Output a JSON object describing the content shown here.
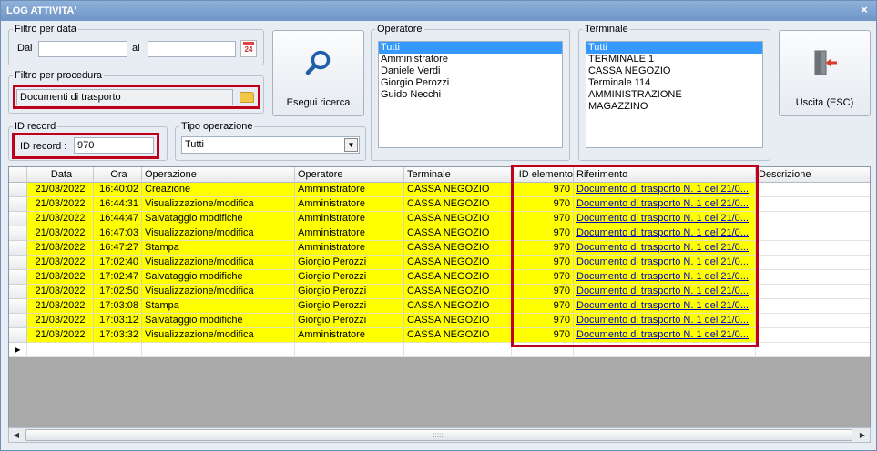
{
  "window": {
    "title": "LOG ATTIVITA'",
    "close_glyph": "×"
  },
  "filtro_data": {
    "label": "Filtro per data",
    "dal_label": "Dal",
    "al_label": "al",
    "dal_value": "",
    "al_value": "",
    "calendar_text": "24"
  },
  "filtro_procedura": {
    "label": "Filtro per procedura",
    "value": "Documenti di trasporto"
  },
  "id_record": {
    "label": "ID record",
    "field_label": "ID record :",
    "value": "970"
  },
  "tipo_operazione": {
    "label": "Tipo operazione",
    "selected": "Tutti"
  },
  "search_button": {
    "label": "Esegui ricerca"
  },
  "exit_button": {
    "label": "Uscita (ESC)"
  },
  "operatore": {
    "label": "Operatore",
    "items": [
      "Tutti",
      "Amministratore",
      "Daniele Verdi",
      "Giorgio Perozzi",
      "Guido Necchi"
    ],
    "selected_index": 0
  },
  "terminale": {
    "label": "Terminale",
    "items": [
      "Tutti",
      "TERMINALE 1",
      "CASSA NEGOZIO",
      "Terminale 114",
      "AMMINISTRAZIONE",
      "MAGAZZINO"
    ],
    "selected_index": 0
  },
  "grid": {
    "headers": [
      "Data",
      "Ora",
      "Operazione",
      "Operatore",
      "Terminale",
      "ID elemento",
      "Riferimento",
      "Descrizione"
    ],
    "rows": [
      [
        "21/03/2022",
        "16:40:02",
        "Creazione",
        "Amministratore",
        "CASSA NEGOZIO",
        "970",
        "Documento di trasporto N. 1 del 21/0...",
        ""
      ],
      [
        "21/03/2022",
        "16:44:31",
        "Visualizzazione/modifica",
        "Amministratore",
        "CASSA NEGOZIO",
        "970",
        "Documento di trasporto N. 1 del 21/0...",
        ""
      ],
      [
        "21/03/2022",
        "16:44:47",
        "Salvataggio modifiche",
        "Amministratore",
        "CASSA NEGOZIO",
        "970",
        "Documento di trasporto N. 1 del 21/0...",
        ""
      ],
      [
        "21/03/2022",
        "16:47:03",
        "Visualizzazione/modifica",
        "Amministratore",
        "CASSA NEGOZIO",
        "970",
        "Documento di trasporto N. 1 del 21/0...",
        ""
      ],
      [
        "21/03/2022",
        "16:47:27",
        "Stampa",
        "Amministratore",
        "CASSA NEGOZIO",
        "970",
        "Documento di trasporto N. 1 del 21/0...",
        ""
      ],
      [
        "21/03/2022",
        "17:02:40",
        "Visualizzazione/modifica",
        "Giorgio Perozzi",
        "CASSA NEGOZIO",
        "970",
        "Documento di trasporto N. 1 del 21/0...",
        ""
      ],
      [
        "21/03/2022",
        "17:02:47",
        "Salvataggio modifiche",
        "Giorgio Perozzi",
        "CASSA NEGOZIO",
        "970",
        "Documento di trasporto N. 1 del 21/0...",
        ""
      ],
      [
        "21/03/2022",
        "17:02:50",
        "Visualizzazione/modifica",
        "Giorgio Perozzi",
        "CASSA NEGOZIO",
        "970",
        "Documento di trasporto N. 1 del 21/0...",
        ""
      ],
      [
        "21/03/2022",
        "17:03:08",
        "Stampa",
        "Giorgio Perozzi",
        "CASSA NEGOZIO",
        "970",
        "Documento di trasporto N. 1 del 21/0...",
        ""
      ],
      [
        "21/03/2022",
        "17:03:12",
        "Salvataggio modifiche",
        "Giorgio Perozzi",
        "CASSA NEGOZIO",
        "970",
        "Documento di trasporto N. 1 del 21/0...",
        ""
      ],
      [
        "21/03/2022",
        "17:03:32",
        "Visualizzazione/modifica",
        "Amministratore",
        "CASSA NEGOZIO",
        "970",
        "Documento di trasporto N. 1 del 21/0...",
        ""
      ]
    ],
    "new_row_glyph": "▶",
    "scroll_grip": "::::::"
  },
  "colors": {
    "row_highlight": "#ffff00",
    "selection": "#3399ff",
    "annotation_box": "#c0001b",
    "title_bar": "#7ba0cf"
  },
  "icons": [
    "search-icon",
    "exit-door-icon",
    "calendar-icon",
    "folder-icon",
    "close-icon",
    "chevron-down-icon"
  ]
}
